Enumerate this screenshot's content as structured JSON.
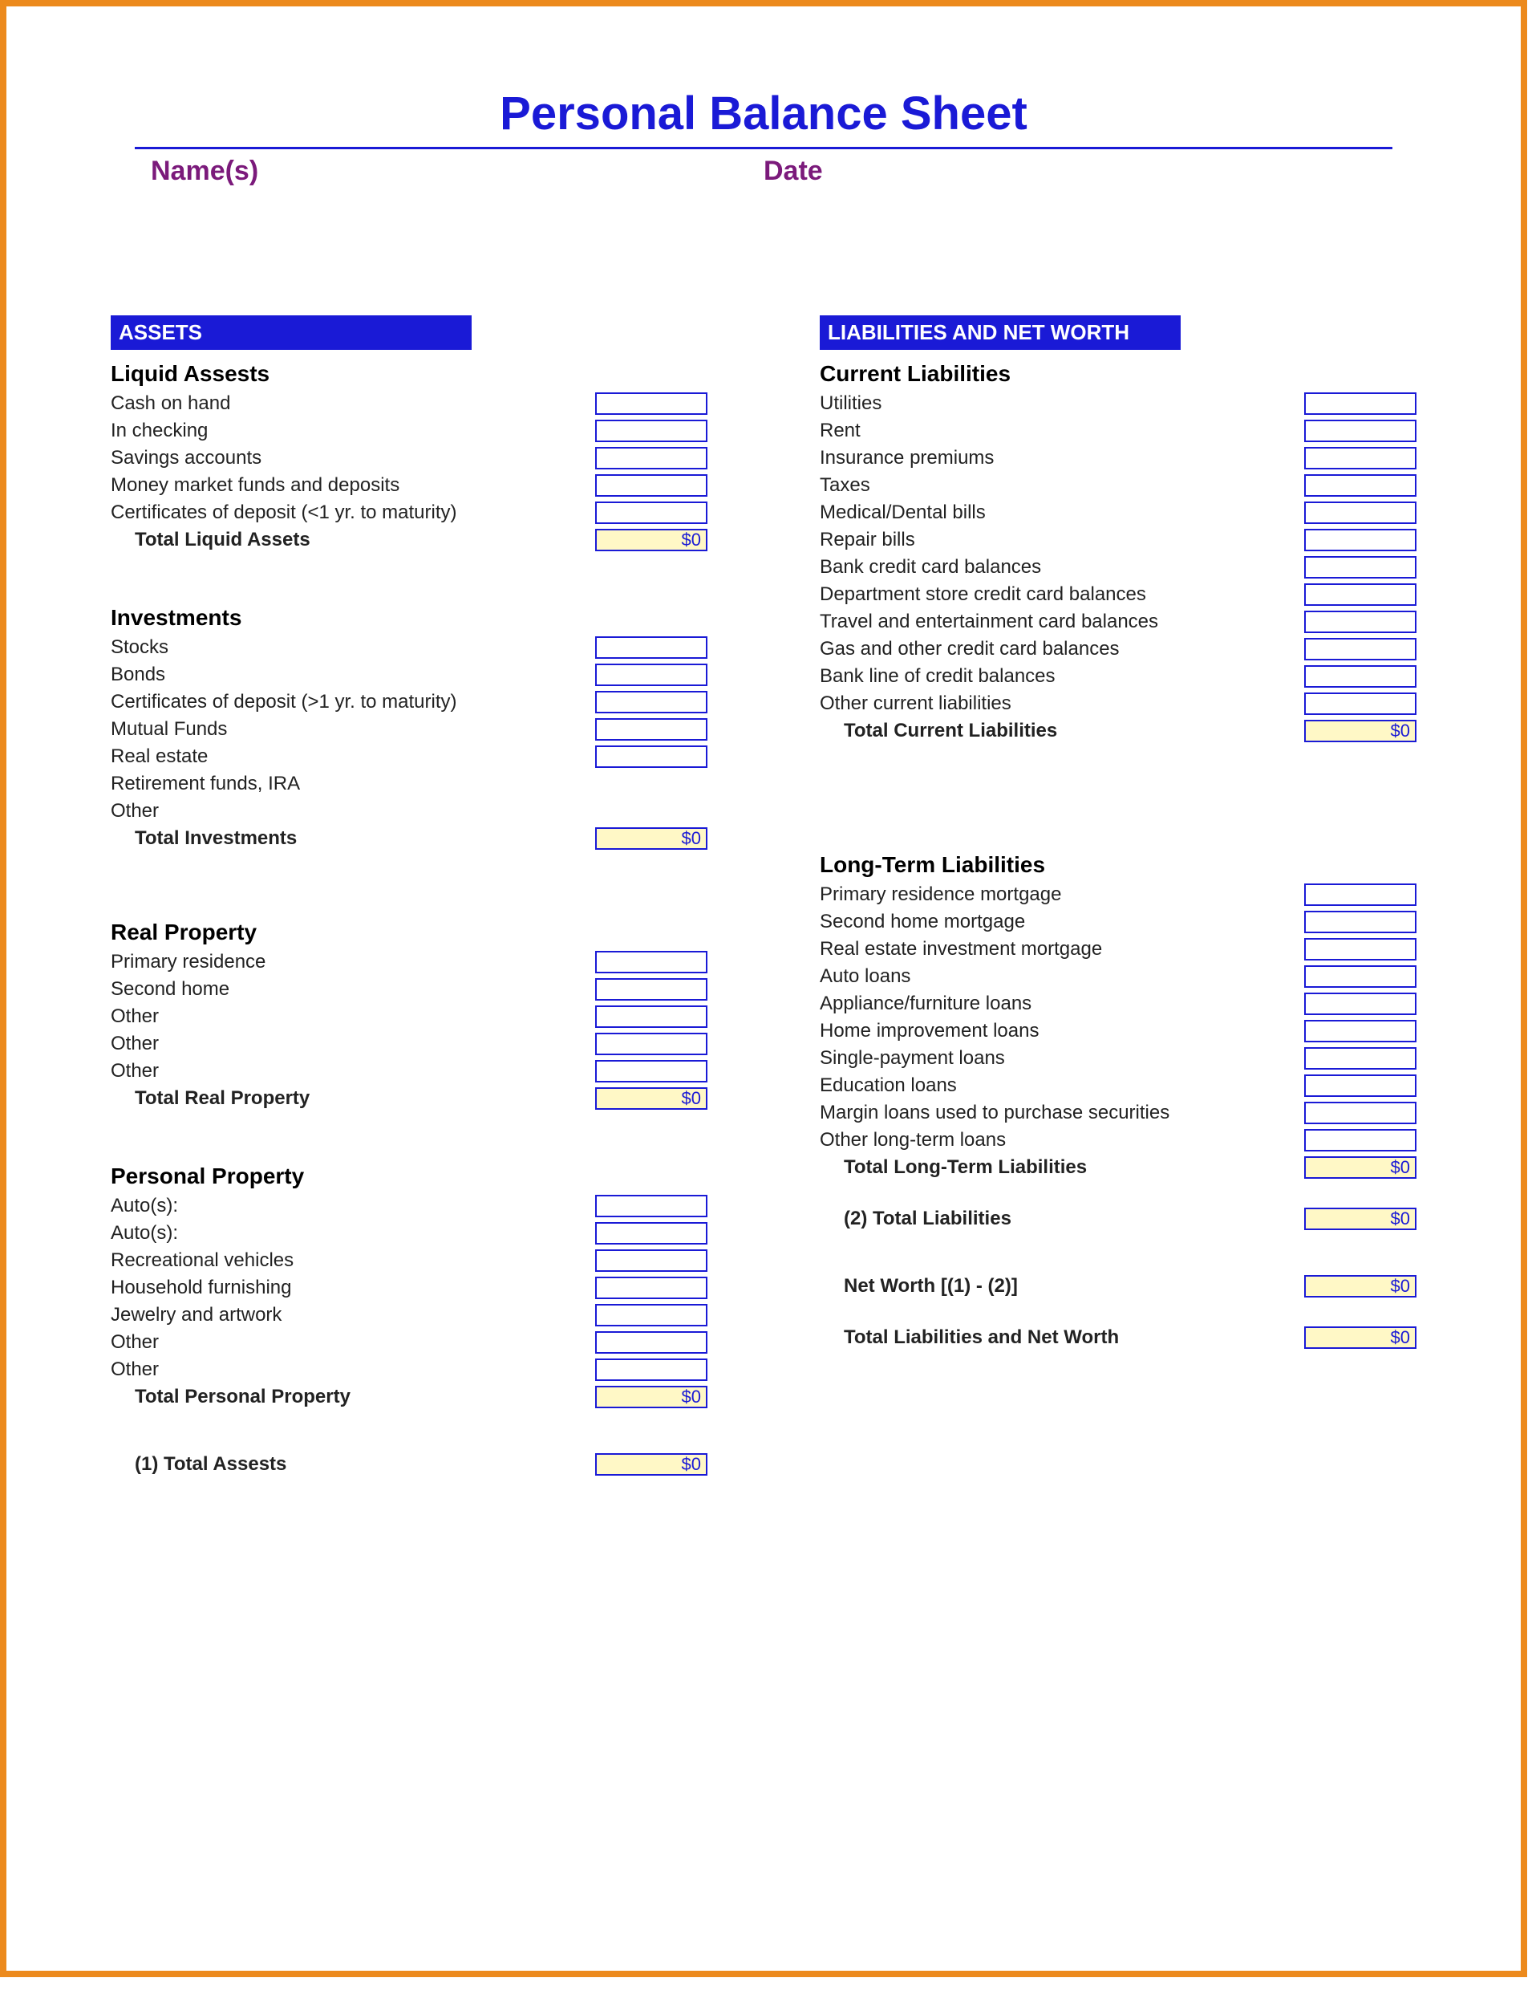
{
  "title": "Personal Balance Sheet",
  "meta": {
    "names_label": "Name(s)",
    "date_label": "Date"
  },
  "banners": {
    "assets": "ASSETS",
    "liabilities": "LIABILITIES AND NET WORTH"
  },
  "assets": {
    "liquid": {
      "heading": "Liquid Assests",
      "items": [
        "Cash on hand",
        "In checking",
        "Savings accounts",
        "Money market funds and deposits",
        "Certificates of deposit (<1 yr. to maturity)"
      ],
      "total_label": "Total Liquid Assets",
      "total_value": "$0"
    },
    "investments": {
      "heading": "Investments",
      "items": [
        "Stocks",
        "Bonds",
        "Certificates of deposit (>1 yr. to maturity)",
        "Mutual Funds",
        "Real estate",
        "Retirement funds, IRA",
        "Other"
      ],
      "item_has_cell": [
        true,
        true,
        true,
        true,
        true,
        false,
        false
      ],
      "total_label": "Total Investments",
      "total_value": "$0"
    },
    "real_property": {
      "heading": "Real Property",
      "items": [
        "Primary residence",
        "Second home",
        "Other",
        "Other",
        "Other"
      ],
      "total_label": "Total Real Property",
      "total_value": "$0"
    },
    "personal_property": {
      "heading": "Personal Property",
      "items": [
        "Auto(s):",
        "Auto(s):",
        "Recreational vehicles",
        "Household furnishing",
        "Jewelry and artwork",
        "Other",
        "Other"
      ],
      "total_label": "Total Personal Property",
      "total_value": "$0"
    },
    "grand_total_label": "(1) Total Assests",
    "grand_total_value": "$0"
  },
  "liabilities": {
    "current": {
      "heading": "Current Liabilities",
      "items": [
        "Utilities",
        "Rent",
        "Insurance premiums",
        "Taxes",
        "Medical/Dental bills",
        "Repair bills",
        "Bank credit card balances",
        "Department store credit card balances",
        "Travel and entertainment card balances",
        "Gas and other credit card balances",
        "Bank line of credit balances",
        "Other current liabilities"
      ],
      "total_label": "Total Current Liabilities",
      "total_value": "$0"
    },
    "long_term": {
      "heading": "Long-Term Liabilities",
      "items": [
        "Primary residence mortgage",
        "Second home mortgage",
        "Real estate investment mortgage",
        "Auto loans",
        "Appliance/furniture loans",
        "Home improvement loans",
        "Single-payment loans",
        "Education loans",
        "Margin loans used to purchase securities",
        "Other long-term loans"
      ],
      "total_label": "Total Long-Term Liabilities",
      "total_value": "$0"
    },
    "total_liab_label": "(2) Total Liabilities",
    "total_liab_value": "$0",
    "net_worth_label": "Net Worth [(1) - (2)]",
    "net_worth_value": "$0",
    "grand_total_label": "Total Liabilities and Net Worth",
    "grand_total_value": "$0"
  }
}
